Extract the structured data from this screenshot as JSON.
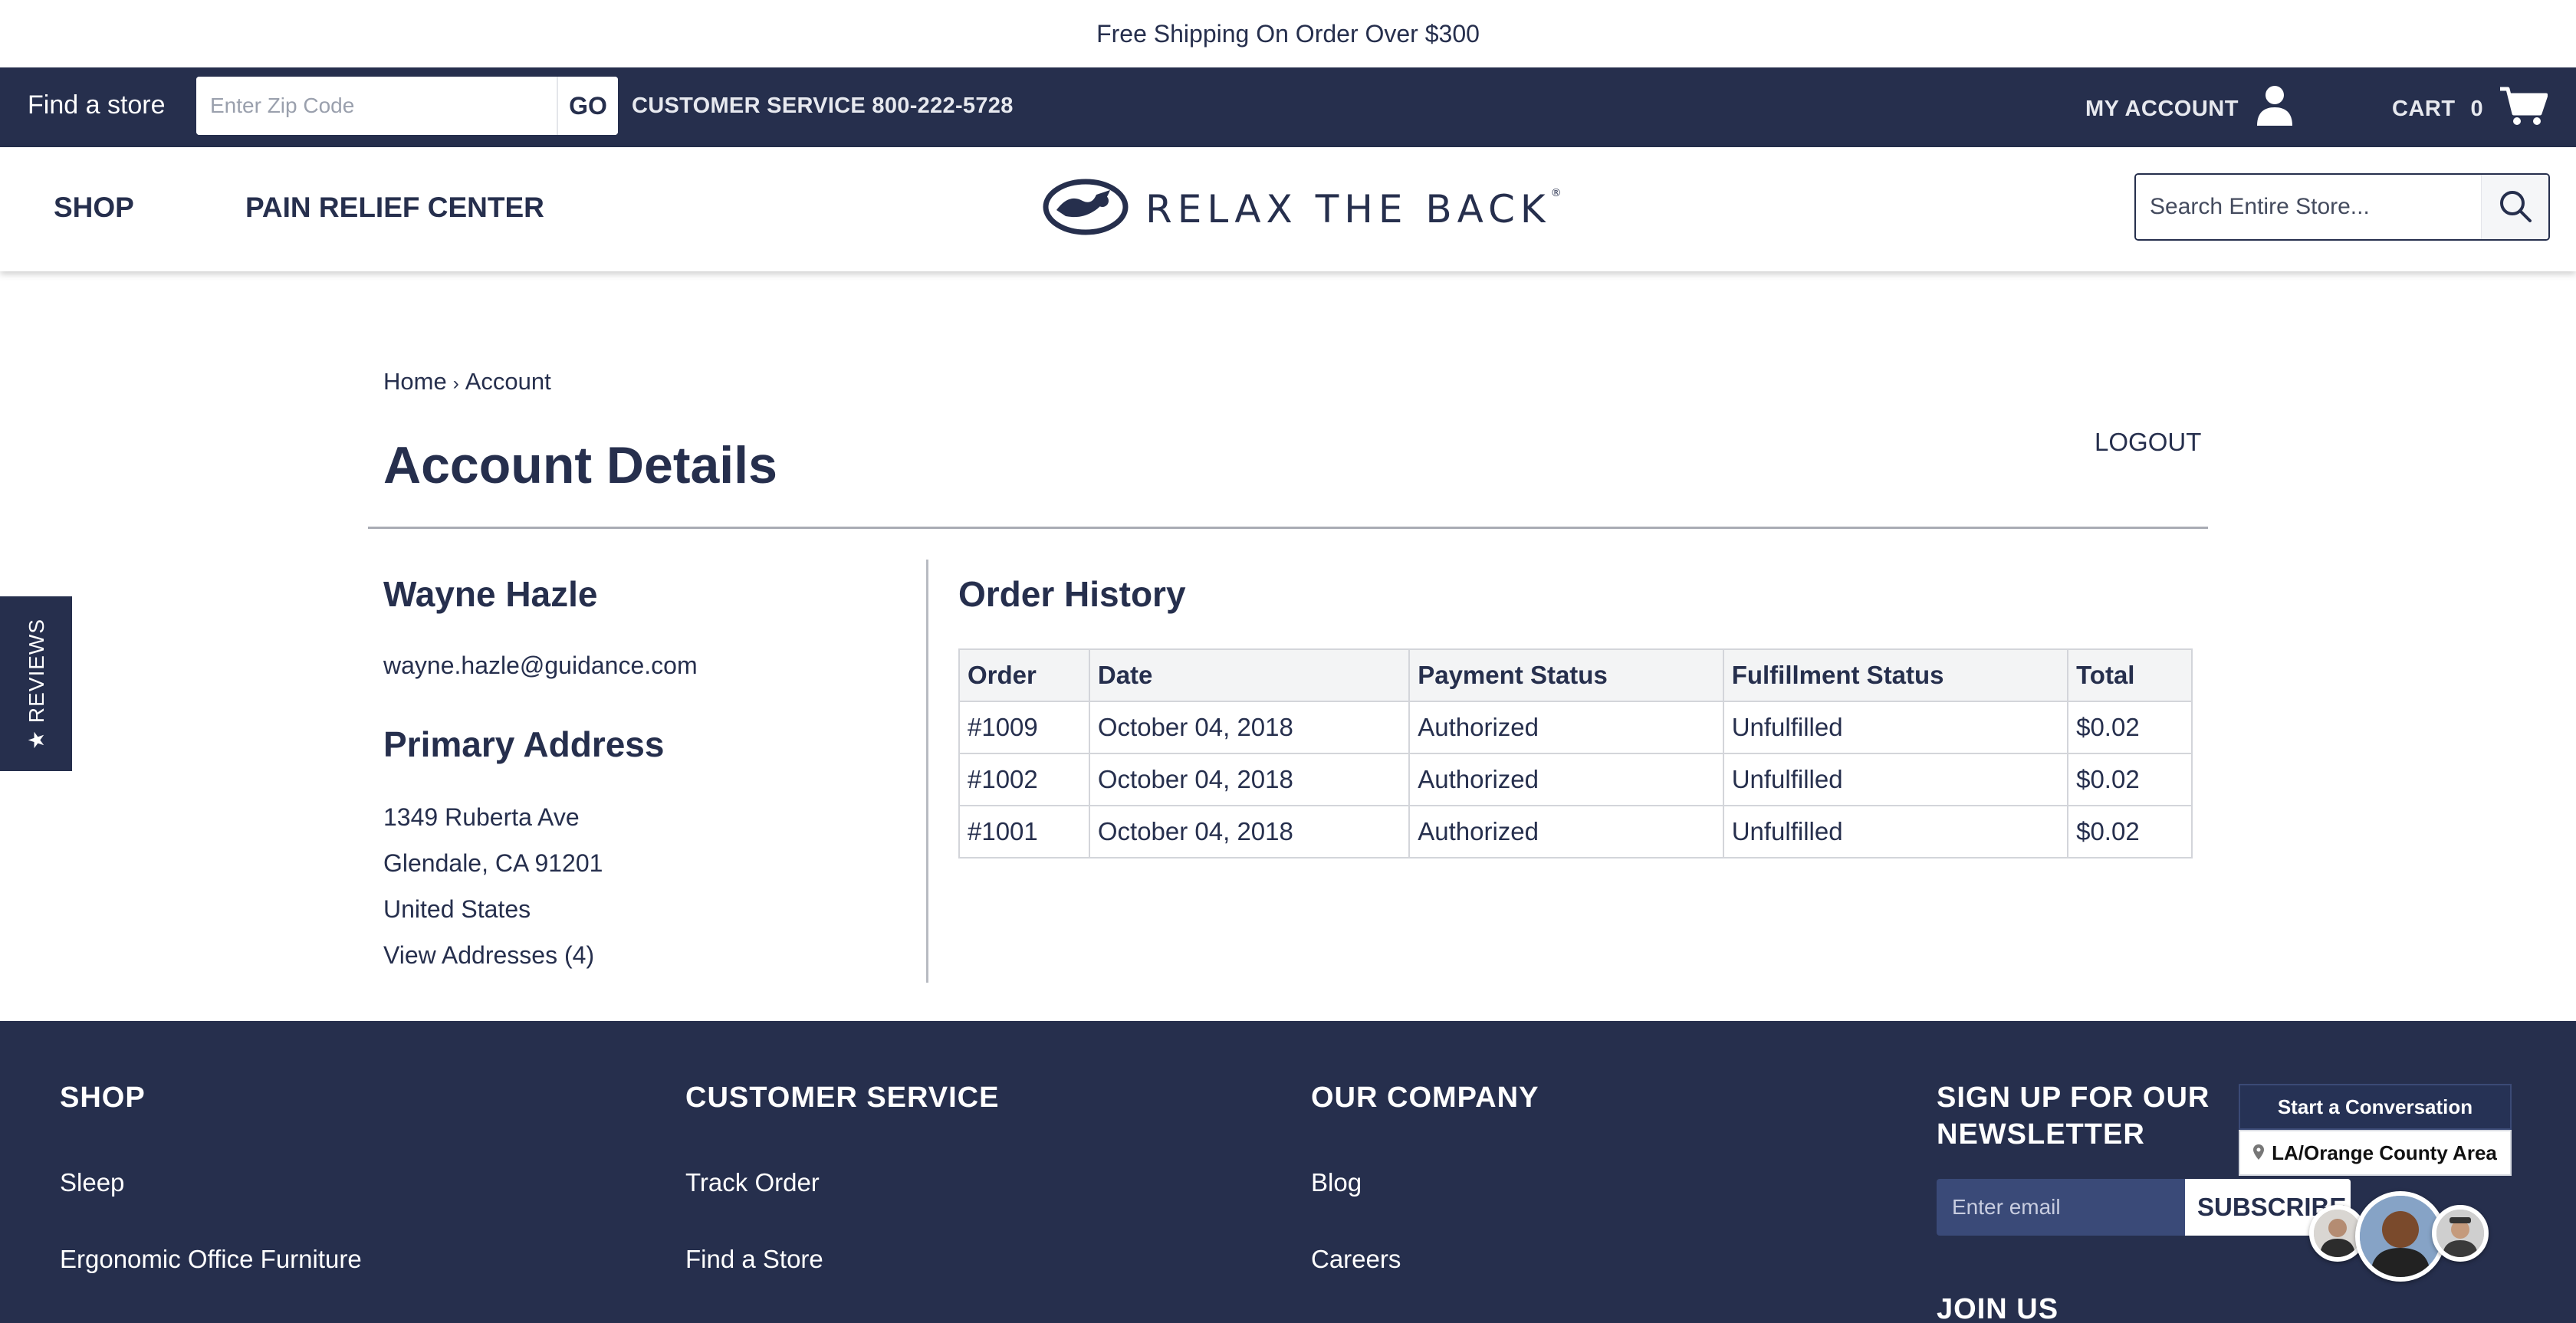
{
  "announcement": "Free Shipping On Order Over $300",
  "utility": {
    "find_store": "Find a store",
    "zip_placeholder": "Enter Zip Code",
    "go": "GO",
    "customer_service": "CUSTOMER SERVICE 800-222-5728",
    "my_account": "MY ACCOUNT",
    "cart_label": "CART",
    "cart_count": "0"
  },
  "header": {
    "nav": [
      "SHOP",
      "PAIN RELIEF CENTER"
    ],
    "logo_text": "RELAX THE BACK",
    "logo_mark": "®",
    "search_placeholder": "Search Entire Store..."
  },
  "breadcrumb": {
    "home": "Home",
    "separator": "›",
    "current": "Account"
  },
  "page": {
    "title": "Account Details",
    "logout": "LOGOUT"
  },
  "customer": {
    "name": "Wayne Hazle",
    "email": "wayne.hazle@guidance.com",
    "address_heading": "Primary Address",
    "address_lines": [
      "1349 Ruberta Ave",
      "Glendale, CA 91201",
      "United States"
    ],
    "view_addresses": "View Addresses (4)"
  },
  "orders": {
    "heading": "Order History",
    "columns": [
      "Order",
      "Date",
      "Payment Status",
      "Fulfillment Status",
      "Total"
    ],
    "rows": [
      [
        "#1009",
        "October 04, 2018",
        "Authorized",
        "Unfulfilled",
        "$0.02"
      ],
      [
        "#1002",
        "October 04, 2018",
        "Authorized",
        "Unfulfilled",
        "$0.02"
      ],
      [
        "#1001",
        "October 04, 2018",
        "Authorized",
        "Unfulfilled",
        "$0.02"
      ]
    ]
  },
  "reviews_tab": "★ REVIEWS",
  "footer": {
    "columns": [
      {
        "heading": "SHOP",
        "links": [
          "Sleep",
          "Ergonomic Office Furniture"
        ]
      },
      {
        "heading": "CUSTOMER SERVICE",
        "links": [
          "Track Order",
          "Find a Store"
        ]
      },
      {
        "heading": "OUR COMPANY",
        "links": [
          "Blog",
          "Careers"
        ]
      }
    ],
    "newsletter": {
      "heading": "SIGN UP FOR OUR NEWSLETTER",
      "email_placeholder": "Enter email",
      "subscribe": "SUBSCRIBE"
    },
    "join_us": "JOIN US"
  },
  "chat": {
    "start": "Start a Conversation",
    "area": "LA/Orange County Area"
  },
  "colors": {
    "brand_navy": "#262f4d",
    "footer_input": "#3a4a78",
    "text_on_dark": "#ffffff"
  },
  "icons": [
    "user-icon",
    "cart-icon",
    "search-icon",
    "star-icon",
    "location-pin-icon",
    "relax-the-back-logo"
  ]
}
